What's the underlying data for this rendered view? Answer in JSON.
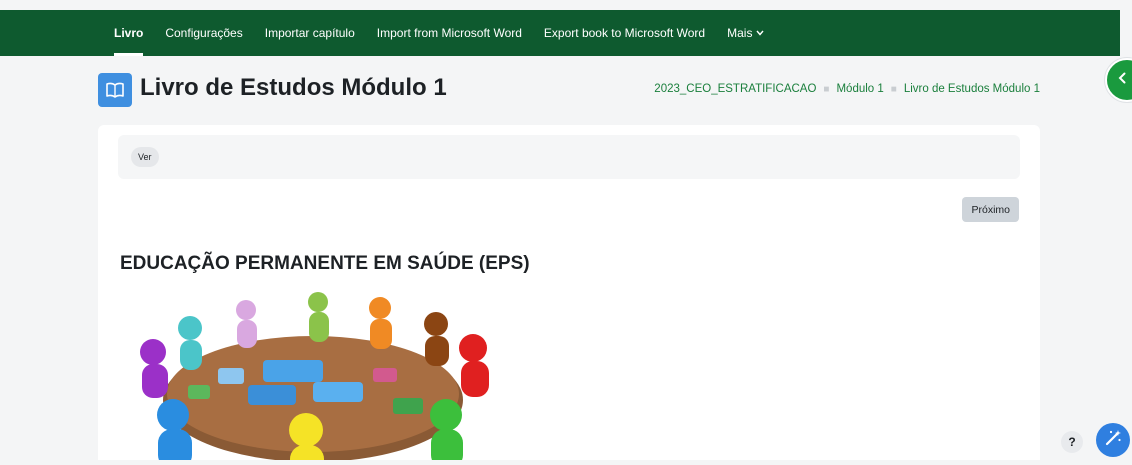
{
  "topnav": {
    "items": [
      {
        "label": "Livro",
        "active": true
      },
      {
        "label": "Configurações",
        "active": false
      },
      {
        "label": "Importar capítulo",
        "active": false
      },
      {
        "label": "Import from Microsoft Word",
        "active": false
      },
      {
        "label": "Export book to Microsoft Word",
        "active": false
      },
      {
        "label": "Mais",
        "active": false
      }
    ]
  },
  "header": {
    "title": "Livro de Estudos Módulo 1",
    "icon": "book-icon",
    "breadcrumb": [
      "2023_CEO_ESTRATIFICACAO",
      "Módulo 1",
      "Livro de Estudos Módulo 1"
    ]
  },
  "secondary_nav": {
    "pill_label": "Ver"
  },
  "content": {
    "next_label": "Próximo",
    "chapter_title": "EDUCAÇÃO PERMANENTE EM SAÚDE (EPS)"
  },
  "floating": {
    "help_label": "?",
    "drawer_icon": "chevron-left-icon",
    "assist_icon": "magic-wand-icon"
  },
  "colors": {
    "brand_green": "#0e5a2f",
    "link_green": "#1a7f3c",
    "accent_blue": "#3f8fe0",
    "background": "#f4f5f6"
  }
}
